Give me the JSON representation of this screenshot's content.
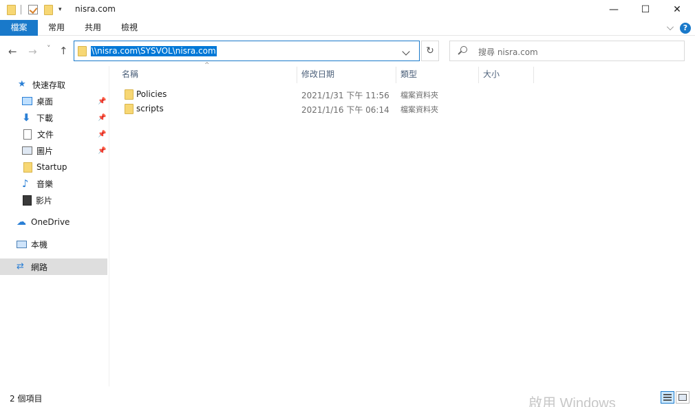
{
  "window": {
    "title": "nisra.com",
    "minimize_glyph": "—",
    "maximize_glyph": "☐",
    "close_glyph": "✕"
  },
  "quick_access_toolbar": {
    "dropdown_glyph": "▾"
  },
  "ribbon": {
    "tabs": [
      "檔案",
      "常用",
      "共用",
      "檢視"
    ],
    "help_glyph": "?"
  },
  "navigation": {
    "back_glyph": "←",
    "forward_glyph": "→",
    "recent_glyph": "˅",
    "up_glyph": "↑",
    "address": "\\\\nisra.com\\SYSVOL\\nisra.com",
    "refresh_glyph": "↻",
    "search_placeholder": "搜尋 nisra.com"
  },
  "sidebar": {
    "pin_glyph": "📌",
    "items": [
      {
        "label": "快速存取",
        "icon": "star-icon",
        "glyph": "★"
      },
      {
        "label": "桌面",
        "icon": "desktop-icon",
        "pinned": true
      },
      {
        "label": "下載",
        "icon": "download-icon",
        "glyph": "⬇",
        "pinned": true
      },
      {
        "label": "文件",
        "icon": "document-icon",
        "pinned": true
      },
      {
        "label": "圖片",
        "icon": "pictures-icon",
        "pinned": true
      },
      {
        "label": "Startup",
        "icon": "folder-icon"
      },
      {
        "label": "音樂",
        "icon": "music-icon",
        "glyph": "♪"
      },
      {
        "label": "影片",
        "icon": "video-icon"
      },
      {
        "label": "OneDrive",
        "icon": "cloud-icon",
        "glyph": "☁"
      },
      {
        "label": "本機",
        "icon": "computer-icon"
      },
      {
        "label": "網路",
        "icon": "network-icon",
        "glyph": "⇄",
        "selected": true
      }
    ]
  },
  "file_list": {
    "sort_glyph": "^",
    "columns": [
      "名稱",
      "修改日期",
      "類型",
      "大小"
    ],
    "rows": [
      {
        "name": "Policies",
        "modified": "2021/1/31 下午 11:56",
        "type": "檔案資料夾",
        "size": ""
      },
      {
        "name": "scripts",
        "modified": "2021/1/16 下午 06:14",
        "type": "檔案資料夾",
        "size": ""
      }
    ]
  },
  "status_bar": {
    "item_count": "2 個項目",
    "watermark": "啟用 Windows"
  },
  "colors": {
    "accent": "#1979ca",
    "selection": "#0078d7",
    "folder": "#f7d774"
  }
}
